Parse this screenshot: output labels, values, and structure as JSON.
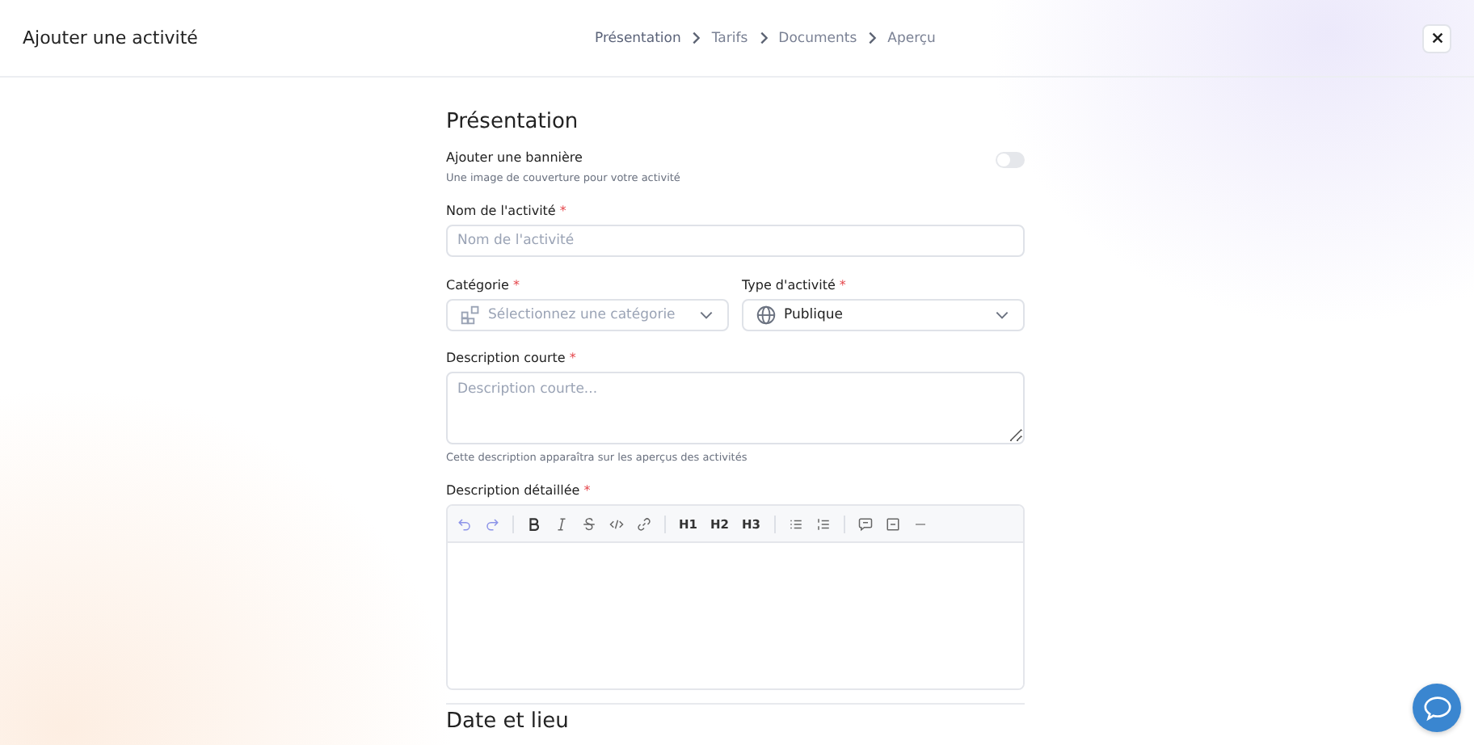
{
  "header": {
    "title": "Ajouter une activité",
    "steps": [
      {
        "label": "Présentation",
        "selected": true
      },
      {
        "label": "Tarifs",
        "selected": false
      },
      {
        "label": "Documents",
        "selected": false
      },
      {
        "label": "Aperçu",
        "selected": false
      }
    ]
  },
  "section_title": "Présentation",
  "banner": {
    "label": "Ajouter une bannière",
    "hint": "Une image de couverture pour votre activité",
    "on": false
  },
  "name_field": {
    "label": "Nom de l'activité",
    "required": "*",
    "placeholder": "Nom de l'activité"
  },
  "category_field": {
    "label": "Catégorie",
    "required": "*",
    "placeholder": "Sélectionnez une catégorie"
  },
  "type_field": {
    "label": "Type d'activité",
    "required": "*",
    "value": "Publique"
  },
  "short_description": {
    "label": "Description courte",
    "required": "*",
    "placeholder": "Description courte...",
    "hint": "Cette description apparaîtra sur les aperçus des activités"
  },
  "long_description": {
    "label": "Description détaillée",
    "required": "*",
    "headings": [
      "H1",
      "H2",
      "H3"
    ]
  },
  "next_section_title": "Date et lieu"
}
